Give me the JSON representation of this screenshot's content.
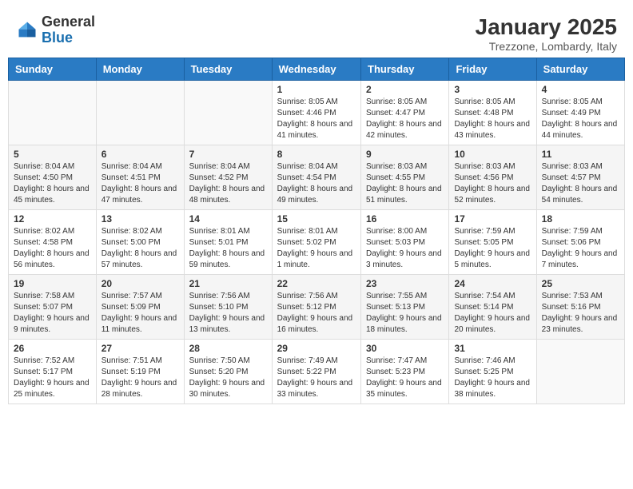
{
  "header": {
    "logo_general": "General",
    "logo_blue": "Blue",
    "month": "January 2025",
    "location": "Trezzone, Lombardy, Italy"
  },
  "weekdays": [
    "Sunday",
    "Monday",
    "Tuesday",
    "Wednesday",
    "Thursday",
    "Friday",
    "Saturday"
  ],
  "weeks": [
    [
      {
        "day": "",
        "info": ""
      },
      {
        "day": "",
        "info": ""
      },
      {
        "day": "",
        "info": ""
      },
      {
        "day": "1",
        "info": "Sunrise: 8:05 AM\nSunset: 4:46 PM\nDaylight: 8 hours and 41 minutes."
      },
      {
        "day": "2",
        "info": "Sunrise: 8:05 AM\nSunset: 4:47 PM\nDaylight: 8 hours and 42 minutes."
      },
      {
        "day": "3",
        "info": "Sunrise: 8:05 AM\nSunset: 4:48 PM\nDaylight: 8 hours and 43 minutes."
      },
      {
        "day": "4",
        "info": "Sunrise: 8:05 AM\nSunset: 4:49 PM\nDaylight: 8 hours and 44 minutes."
      }
    ],
    [
      {
        "day": "5",
        "info": "Sunrise: 8:04 AM\nSunset: 4:50 PM\nDaylight: 8 hours and 45 minutes."
      },
      {
        "day": "6",
        "info": "Sunrise: 8:04 AM\nSunset: 4:51 PM\nDaylight: 8 hours and 47 minutes."
      },
      {
        "day": "7",
        "info": "Sunrise: 8:04 AM\nSunset: 4:52 PM\nDaylight: 8 hours and 48 minutes."
      },
      {
        "day": "8",
        "info": "Sunrise: 8:04 AM\nSunset: 4:54 PM\nDaylight: 8 hours and 49 minutes."
      },
      {
        "day": "9",
        "info": "Sunrise: 8:03 AM\nSunset: 4:55 PM\nDaylight: 8 hours and 51 minutes."
      },
      {
        "day": "10",
        "info": "Sunrise: 8:03 AM\nSunset: 4:56 PM\nDaylight: 8 hours and 52 minutes."
      },
      {
        "day": "11",
        "info": "Sunrise: 8:03 AM\nSunset: 4:57 PM\nDaylight: 8 hours and 54 minutes."
      }
    ],
    [
      {
        "day": "12",
        "info": "Sunrise: 8:02 AM\nSunset: 4:58 PM\nDaylight: 8 hours and 56 minutes."
      },
      {
        "day": "13",
        "info": "Sunrise: 8:02 AM\nSunset: 5:00 PM\nDaylight: 8 hours and 57 minutes."
      },
      {
        "day": "14",
        "info": "Sunrise: 8:01 AM\nSunset: 5:01 PM\nDaylight: 8 hours and 59 minutes."
      },
      {
        "day": "15",
        "info": "Sunrise: 8:01 AM\nSunset: 5:02 PM\nDaylight: 9 hours and 1 minute."
      },
      {
        "day": "16",
        "info": "Sunrise: 8:00 AM\nSunset: 5:03 PM\nDaylight: 9 hours and 3 minutes."
      },
      {
        "day": "17",
        "info": "Sunrise: 7:59 AM\nSunset: 5:05 PM\nDaylight: 9 hours and 5 minutes."
      },
      {
        "day": "18",
        "info": "Sunrise: 7:59 AM\nSunset: 5:06 PM\nDaylight: 9 hours and 7 minutes."
      }
    ],
    [
      {
        "day": "19",
        "info": "Sunrise: 7:58 AM\nSunset: 5:07 PM\nDaylight: 9 hours and 9 minutes."
      },
      {
        "day": "20",
        "info": "Sunrise: 7:57 AM\nSunset: 5:09 PM\nDaylight: 9 hours and 11 minutes."
      },
      {
        "day": "21",
        "info": "Sunrise: 7:56 AM\nSunset: 5:10 PM\nDaylight: 9 hours and 13 minutes."
      },
      {
        "day": "22",
        "info": "Sunrise: 7:56 AM\nSunset: 5:12 PM\nDaylight: 9 hours and 16 minutes."
      },
      {
        "day": "23",
        "info": "Sunrise: 7:55 AM\nSunset: 5:13 PM\nDaylight: 9 hours and 18 minutes."
      },
      {
        "day": "24",
        "info": "Sunrise: 7:54 AM\nSunset: 5:14 PM\nDaylight: 9 hours and 20 minutes."
      },
      {
        "day": "25",
        "info": "Sunrise: 7:53 AM\nSunset: 5:16 PM\nDaylight: 9 hours and 23 minutes."
      }
    ],
    [
      {
        "day": "26",
        "info": "Sunrise: 7:52 AM\nSunset: 5:17 PM\nDaylight: 9 hours and 25 minutes."
      },
      {
        "day": "27",
        "info": "Sunrise: 7:51 AM\nSunset: 5:19 PM\nDaylight: 9 hours and 28 minutes."
      },
      {
        "day": "28",
        "info": "Sunrise: 7:50 AM\nSunset: 5:20 PM\nDaylight: 9 hours and 30 minutes."
      },
      {
        "day": "29",
        "info": "Sunrise: 7:49 AM\nSunset: 5:22 PM\nDaylight: 9 hours and 33 minutes."
      },
      {
        "day": "30",
        "info": "Sunrise: 7:47 AM\nSunset: 5:23 PM\nDaylight: 9 hours and 35 minutes."
      },
      {
        "day": "31",
        "info": "Sunrise: 7:46 AM\nSunset: 5:25 PM\nDaylight: 9 hours and 38 minutes."
      },
      {
        "day": "",
        "info": ""
      }
    ]
  ]
}
